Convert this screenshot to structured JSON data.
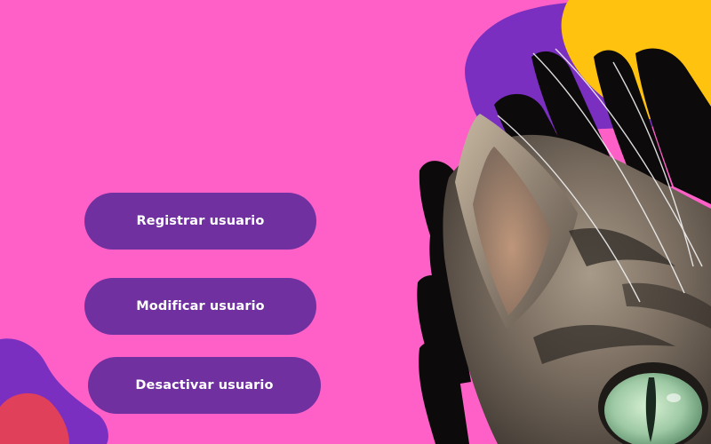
{
  "theme": {
    "background": "#ff60c7",
    "button_color": "#7030a0",
    "button_text_color": "#ffffff",
    "accent_yellow": "#ffc20e",
    "accent_purple": "#7b2fc0",
    "accent_red": "#e0405a"
  },
  "menu": {
    "buttons": [
      {
        "id": "register",
        "label": "Registrar usuario"
      },
      {
        "id": "modify",
        "label": "Modificar usuario"
      },
      {
        "id": "deactivate",
        "label": "Desactivar usuario"
      }
    ]
  },
  "decoration": {
    "cat_illustration_icon": "cat-icon"
  }
}
